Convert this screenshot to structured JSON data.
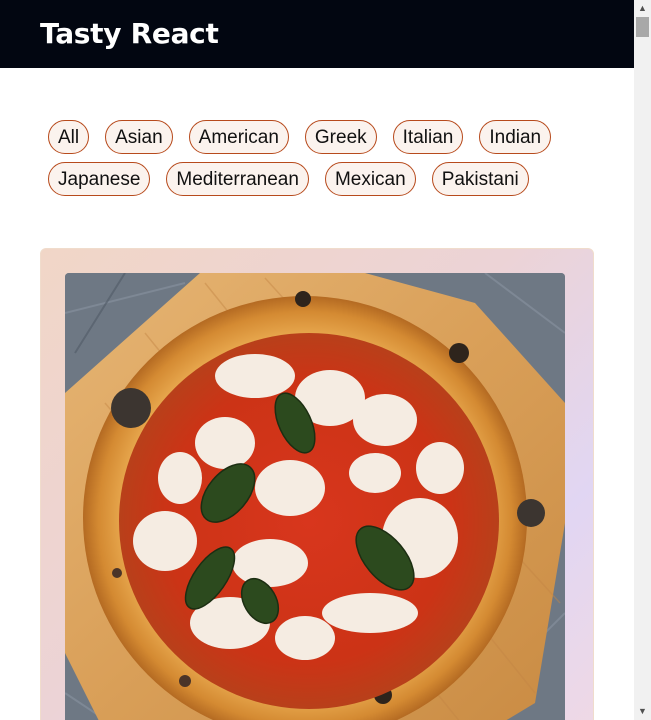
{
  "header": {
    "title": "Tasty React"
  },
  "filters": {
    "rows": [
      [
        "All",
        "Asian",
        "American",
        "Greek",
        "Italian",
        "Indian"
      ],
      [
        "Japanese",
        "Mediterranean",
        "Mexican",
        "Pakistani"
      ]
    ]
  },
  "recipe_card": {
    "image_icon": "pizza-photo"
  },
  "colors": {
    "header_bg": "#020611",
    "chip_border": "#b74a1c",
    "chip_bg": "#fbf3ee"
  }
}
